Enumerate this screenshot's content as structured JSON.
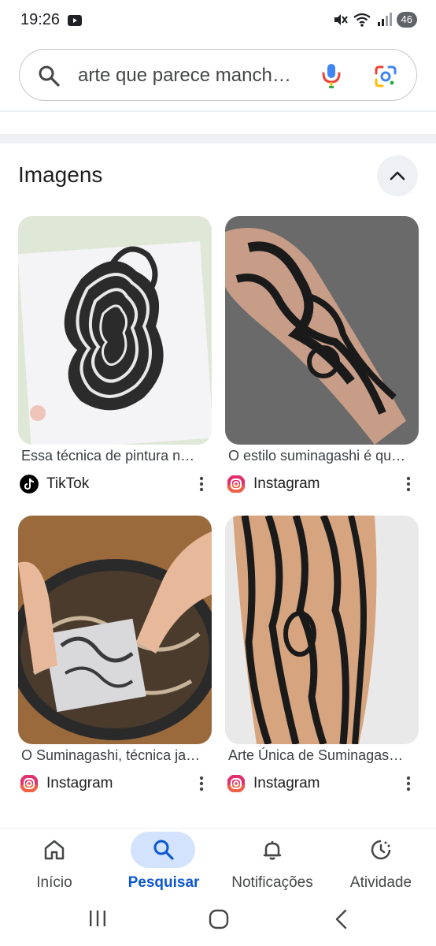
{
  "status_bar": {
    "time": "19:26",
    "battery": "46",
    "icons": [
      "youtube-icon",
      "mute-icon",
      "wifi-icon",
      "signal-icon"
    ]
  },
  "search": {
    "query": "arte que parece manch…",
    "icons": [
      "search-icon",
      "mic-icon",
      "google-lens-icon"
    ]
  },
  "images_section": {
    "title": "Imagens",
    "collapse_icon": "chevron-up-icon",
    "results": [
      {
        "caption": "Essa técnica de pintura n…",
        "source": "TikTok",
        "source_icon": "tiktok-icon"
      },
      {
        "caption": "O estilo suminagashi é qu…",
        "source": "Instagram",
        "source_icon": "instagram-icon"
      },
      {
        "caption": "O Suminagashi, técnica ja…",
        "source": "Instagram",
        "source_icon": "instagram-icon"
      },
      {
        "caption": "Arte Única de Suminagas…",
        "source": "Instagram",
        "source_icon": "instagram-icon"
      }
    ]
  },
  "bottom_nav": {
    "active": "Pesquisar",
    "items": [
      {
        "label": "Início",
        "icon": "home-icon"
      },
      {
        "label": "Pesquisar",
        "icon": "search-icon"
      },
      {
        "label": "Notificações",
        "icon": "bell-icon"
      },
      {
        "label": "Atividade",
        "icon": "activity-icon"
      }
    ]
  },
  "colors": {
    "accent": "#0b57d0",
    "active_pill": "#d3e3fd",
    "divider": "#eef0f3"
  }
}
